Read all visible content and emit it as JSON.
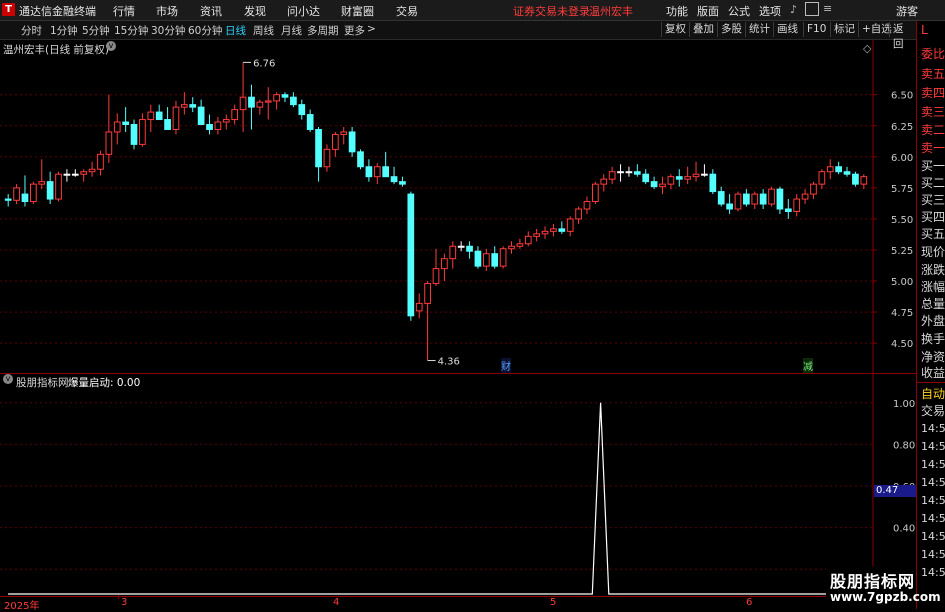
{
  "menubar": {
    "logo": "T",
    "app_title": "通达信金融终端",
    "items": [
      "行情",
      "市场",
      "资讯",
      "发现",
      "问小达",
      "财富圈",
      "交易"
    ],
    "login_status": "证券交易未登录",
    "stock_short": "温州宏丰",
    "right_items": [
      "功能",
      "版面",
      "公式",
      "选项"
    ],
    "guest": "游客"
  },
  "periods": {
    "items": [
      "分时",
      "1分钟",
      "5分钟",
      "15分钟",
      "30分钟",
      "60分钟",
      "日线",
      "周线",
      "月线",
      "多周期",
      "更多"
    ],
    "active": "日线",
    "more_arrow": ">"
  },
  "toolbar": {
    "buttons": [
      "复权",
      "叠加",
      "多股",
      "统计",
      "画线",
      "F10",
      "标记",
      "+自选",
      "返回"
    ]
  },
  "main_chart": {
    "header": "温州宏丰(日线 前复权)",
    "high_label": "6.76",
    "low_label": "4.36",
    "event_labels": [
      "财",
      "减"
    ],
    "colors": {
      "up": "#ff3b3b",
      "down": "#54ffff",
      "flat": "#ffffff"
    }
  },
  "indicator": {
    "name": "股朋指标网",
    "label": "爆量启动: 0.00",
    "current_value": "0.47"
  },
  "right_panel": {
    "red_labels": [
      "L",
      "委比",
      "卖五",
      "卖四",
      "卖三",
      "卖二",
      "卖一"
    ],
    "plain_labels": [
      "买一",
      "买二",
      "买三",
      "买四",
      "买五",
      "现价",
      "涨跌",
      "涨幅",
      "总量",
      "外盘",
      "换手",
      "净资",
      "收益"
    ],
    "auto": "自动",
    "trade": "交易",
    "times": [
      "14:56",
      "14:56",
      "14:56",
      "14:56",
      "14:56",
      "14:56",
      "14:56",
      "14:56",
      "14:56"
    ]
  },
  "x_axis": {
    "labels": [
      "2025年",
      "3",
      "4",
      "5",
      "6"
    ]
  },
  "watermark": {
    "line1": "股朋指标网",
    "line2": "www.7gpzb.com"
  },
  "chart_data": [
    {
      "type": "candlestick",
      "title": "温州宏丰(日线 前复权)",
      "ylim": [
        4.3,
        6.9
      ],
      "y_ticks": [
        4.5,
        4.75,
        5.0,
        5.25,
        5.5,
        5.75,
        6.0,
        6.25,
        6.5
      ],
      "annotations": [
        {
          "text": "6.76",
          "kind": "high"
        },
        {
          "text": "4.36",
          "kind": "low"
        }
      ],
      "ohlc": [
        [
          5.66,
          5.7,
          5.6,
          5.65
        ],
        [
          5.65,
          5.78,
          5.62,
          5.75
        ],
        [
          5.7,
          5.85,
          5.6,
          5.64
        ],
        [
          5.64,
          5.8,
          5.62,
          5.78
        ],
        [
          5.78,
          5.98,
          5.74,
          5.8
        ],
        [
          5.8,
          5.88,
          5.62,
          5.66
        ],
        [
          5.66,
          5.88,
          5.64,
          5.86
        ],
        [
          5.86,
          5.9,
          5.8,
          5.86
        ],
        [
          5.86,
          5.9,
          5.84,
          5.86
        ],
        [
          5.86,
          5.9,
          5.8,
          5.88
        ],
        [
          5.88,
          5.96,
          5.84,
          5.9
        ],
        [
          5.9,
          6.05,
          5.85,
          6.02
        ],
        [
          6.02,
          6.5,
          5.95,
          6.2
        ],
        [
          6.2,
          6.35,
          6.1,
          6.28
        ],
        [
          6.28,
          6.4,
          6.2,
          6.26
        ],
        [
          6.26,
          6.3,
          6.06,
          6.1
        ],
        [
          6.1,
          6.35,
          6.08,
          6.3
        ],
        [
          6.3,
          6.42,
          6.2,
          6.36
        ],
        [
          6.36,
          6.42,
          6.3,
          6.3
        ],
        [
          6.3,
          6.4,
          6.22,
          6.22
        ],
        [
          6.22,
          6.45,
          6.18,
          6.4
        ],
        [
          6.4,
          6.52,
          6.34,
          6.42
        ],
        [
          6.42,
          6.48,
          6.36,
          6.4
        ],
        [
          6.4,
          6.46,
          6.3,
          6.26
        ],
        [
          6.26,
          6.34,
          6.18,
          6.22
        ],
        [
          6.22,
          6.32,
          6.18,
          6.28
        ],
        [
          6.28,
          6.34,
          6.22,
          6.3
        ],
        [
          6.3,
          6.42,
          6.26,
          6.38
        ],
        [
          6.38,
          6.76,
          6.2,
          6.48
        ],
        [
          6.48,
          6.58,
          6.22,
          6.4
        ],
        [
          6.4,
          6.46,
          6.34,
          6.44
        ],
        [
          6.44,
          6.56,
          6.3,
          6.45
        ],
        [
          6.45,
          6.52,
          6.38,
          6.5
        ],
        [
          6.5,
          6.52,
          6.44,
          6.48
        ],
        [
          6.48,
          6.52,
          6.4,
          6.42
        ],
        [
          6.42,
          6.46,
          6.3,
          6.34
        ],
        [
          6.34,
          6.38,
          6.2,
          6.22
        ],
        [
          6.22,
          6.24,
          5.8,
          5.92
        ],
        [
          5.92,
          6.1,
          5.88,
          6.06
        ],
        [
          6.06,
          6.2,
          6.0,
          6.18
        ],
        [
          6.18,
          6.24,
          6.1,
          6.2
        ],
        [
          6.2,
          6.24,
          6.0,
          6.04
        ],
        [
          6.04,
          6.06,
          5.9,
          5.92
        ],
        [
          5.92,
          5.98,
          5.8,
          5.84
        ],
        [
          5.84,
          5.95,
          5.78,
          5.92
        ],
        [
          5.92,
          6.04,
          5.86,
          5.84
        ],
        [
          5.84,
          5.92,
          5.78,
          5.8
        ],
        [
          5.8,
          5.84,
          5.76,
          5.78
        ],
        [
          5.7,
          5.72,
          4.68,
          4.72
        ],
        [
          4.76,
          4.9,
          4.7,
          4.82
        ],
        [
          4.82,
          5.0,
          4.36,
          4.98
        ],
        [
          4.98,
          5.26,
          4.96,
          5.1
        ],
        [
          5.1,
          5.22,
          5.0,
          5.18
        ],
        [
          5.18,
          5.32,
          5.1,
          5.28
        ],
        [
          5.28,
          5.32,
          5.24,
          5.28
        ],
        [
          5.28,
          5.32,
          5.18,
          5.24
        ],
        [
          5.24,
          5.28,
          5.1,
          5.12
        ],
        [
          5.12,
          5.26,
          5.08,
          5.22
        ],
        [
          5.22,
          5.28,
          5.1,
          5.12
        ],
        [
          5.12,
          5.28,
          5.1,
          5.26
        ],
        [
          5.26,
          5.32,
          5.22,
          5.28
        ],
        [
          5.28,
          5.34,
          5.26,
          5.3
        ],
        [
          5.3,
          5.4,
          5.28,
          5.36
        ],
        [
          5.36,
          5.42,
          5.32,
          5.38
        ],
        [
          5.38,
          5.44,
          5.34,
          5.4
        ],
        [
          5.4,
          5.46,
          5.36,
          5.42
        ],
        [
          5.42,
          5.48,
          5.38,
          5.4
        ],
        [
          5.4,
          5.52,
          5.36,
          5.5
        ],
        [
          5.5,
          5.6,
          5.46,
          5.58
        ],
        [
          5.58,
          5.68,
          5.54,
          5.64
        ],
        [
          5.64,
          5.8,
          5.62,
          5.78
        ],
        [
          5.78,
          5.86,
          5.72,
          5.82
        ],
        [
          5.82,
          5.92,
          5.78,
          5.88
        ],
        [
          5.88,
          5.94,
          5.8,
          5.88
        ],
        [
          5.88,
          5.92,
          5.84,
          5.88
        ],
        [
          5.88,
          5.94,
          5.84,
          5.86
        ],
        [
          5.86,
          5.9,
          5.78,
          5.8
        ],
        [
          5.8,
          5.84,
          5.74,
          5.76
        ],
        [
          5.76,
          5.84,
          5.7,
          5.78
        ],
        [
          5.78,
          5.86,
          5.74,
          5.84
        ],
        [
          5.84,
          5.9,
          5.76,
          5.82
        ],
        [
          5.82,
          5.92,
          5.78,
          5.84
        ],
        [
          5.84,
          5.96,
          5.8,
          5.86
        ],
        [
          5.86,
          5.94,
          5.84,
          5.86
        ],
        [
          5.86,
          5.9,
          5.7,
          5.72
        ],
        [
          5.72,
          5.76,
          5.6,
          5.62
        ],
        [
          5.62,
          5.7,
          5.54,
          5.58
        ],
        [
          5.58,
          5.72,
          5.56,
          5.7
        ],
        [
          5.7,
          5.74,
          5.6,
          5.62
        ],
        [
          5.62,
          5.72,
          5.58,
          5.7
        ],
        [
          5.7,
          5.74,
          5.58,
          5.62
        ],
        [
          5.62,
          5.76,
          5.6,
          5.74
        ],
        [
          5.74,
          5.76,
          5.54,
          5.58
        ],
        [
          5.58,
          5.66,
          5.5,
          5.56
        ],
        [
          5.56,
          5.7,
          5.52,
          5.66
        ],
        [
          5.66,
          5.74,
          5.62,
          5.7
        ],
        [
          5.7,
          5.8,
          5.66,
          5.78
        ],
        [
          5.78,
          5.9,
          5.74,
          5.88
        ],
        [
          5.88,
          5.98,
          5.82,
          5.92
        ],
        [
          5.92,
          5.96,
          5.86,
          5.88
        ],
        [
          5.88,
          5.92,
          5.84,
          5.86
        ],
        [
          5.86,
          5.88,
          5.76,
          5.78
        ],
        [
          5.78,
          5.86,
          5.74,
          5.84
        ]
      ]
    },
    {
      "type": "line",
      "title": "爆量启动",
      "ylim": [
        0.1,
        1.1
      ],
      "y_ticks": [
        0.2,
        0.4,
        0.6,
        0.8,
        1.0
      ],
      "spike_index": 72,
      "n": 105,
      "values_note_nonzero": [
        {
          "index": 72,
          "value": 1.0
        }
      ]
    }
  ]
}
